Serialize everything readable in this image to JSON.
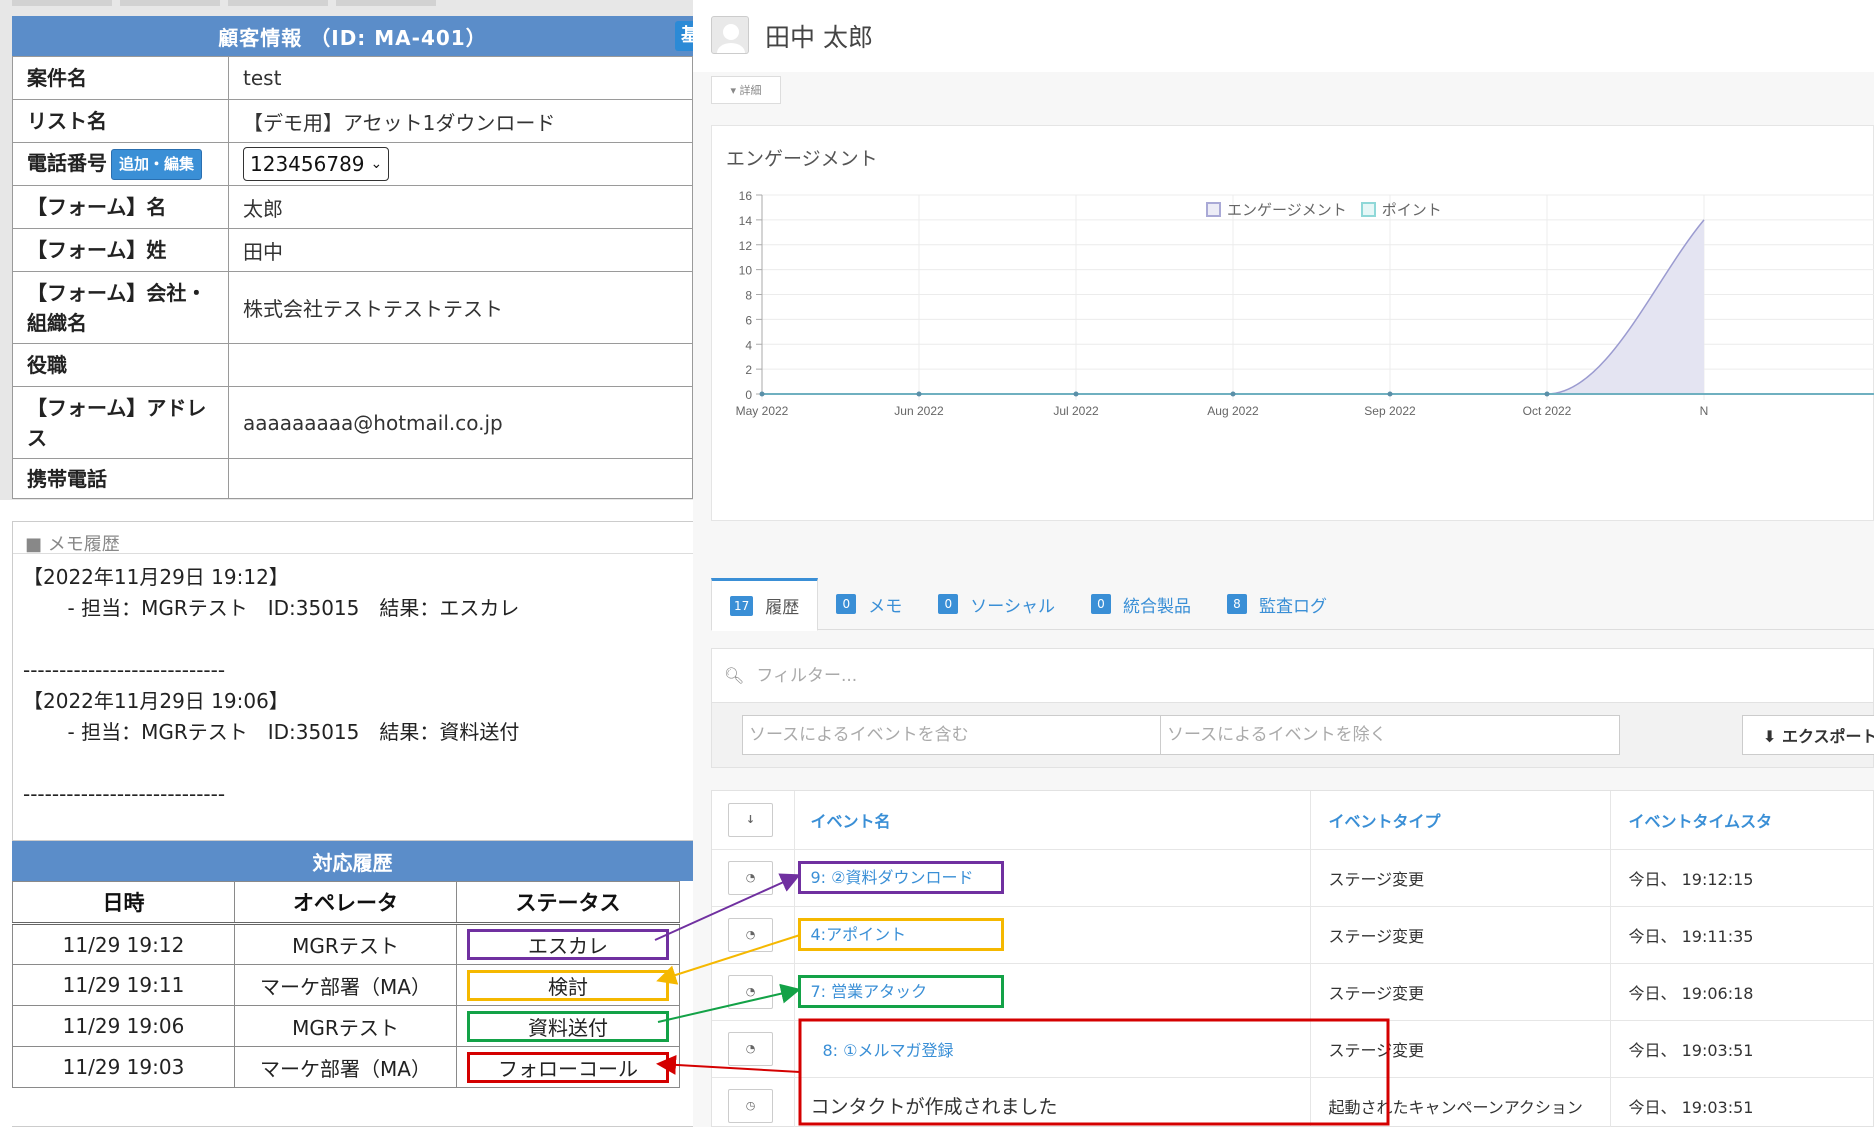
{
  "customer": {
    "header": "顧客情報 （ID: MA-401）",
    "header_btn": "基",
    "rows": [
      {
        "label": "案件名",
        "value": "test"
      },
      {
        "label": "リスト名",
        "value": "【デモ用】アセット1ダウンロード"
      },
      {
        "label": "電話番号",
        "value": "123456789",
        "add_edit": "追加・編集"
      },
      {
        "label": "【フォーム】名",
        "value": "太郎"
      },
      {
        "label": "【フォーム】姓",
        "value": "田中"
      },
      {
        "label": "【フォーム】会社・組織名",
        "value": "株式会社テストテストテスト"
      },
      {
        "label": "役職",
        "value": ""
      },
      {
        "label": "【フォーム】アドレス",
        "value": "aaaaaaaaa@hotmail.co.jp"
      },
      {
        "label": "携帯電話",
        "value": ""
      }
    ]
  },
  "memo": {
    "title": "■ メモ履歴",
    "entries": [
      "【2022年11月29日 19:12】\n       - 担当：MGRテスト　ID:35015　結果：エスカレ\n\n----------------------------",
      "【2022年11月29日 19:06】\n       - 担当：MGRテスト　ID:35015　結果：資料送付\n\n----------------------------"
    ]
  },
  "correspondence": {
    "title": "対応履歴",
    "columns": [
      "日時",
      "オペレータ",
      "ステータス"
    ],
    "rows": [
      {
        "datetime": "11/29 19:12",
        "operator": "MGRテスト",
        "status": "エスカレ",
        "color": "#7030a0"
      },
      {
        "datetime": "11/29 19:11",
        "operator": "マーケ部署（MA）",
        "status": "検討",
        "color": "#f5b800"
      },
      {
        "datetime": "11/29 19:06",
        "operator": "MGRテスト",
        "status": "資料送付",
        "color": "#13a247"
      },
      {
        "datetime": "11/29 19:03",
        "operator": "マーケ部署（MA）",
        "status": "フォローコール",
        "color": "#d40000"
      }
    ]
  },
  "contact": {
    "name": "田中 太郎",
    "detail_label": "▾ 詳細"
  },
  "engagement": {
    "title": "エンゲージメント",
    "legend": [
      "エンゲージメント",
      "ポイント"
    ]
  },
  "chart_data": {
    "type": "area",
    "categories": [
      "May 2022",
      "Jun 2022",
      "Jul 2022",
      "Aug 2022",
      "Sep 2022",
      "Oct 2022",
      "N"
    ],
    "y_ticks": [
      0,
      2,
      4,
      6,
      8,
      10,
      12,
      14,
      16
    ],
    "ylim": [
      0,
      16
    ],
    "grid": true,
    "legend_position": "top-center",
    "series": [
      {
        "name": "エンゲージメント",
        "values": [
          0,
          0,
          0,
          0,
          0,
          0,
          14
        ],
        "color": "#9b9bd0",
        "fill": "#e4e4f2"
      },
      {
        "name": "ポイント",
        "values": [
          0,
          0,
          0,
          0,
          0,
          0,
          0
        ],
        "color": "#7fd0d0"
      }
    ]
  },
  "tabs": [
    {
      "count": "17",
      "label": "履歴",
      "active": true
    },
    {
      "count": "0",
      "label": "メモ"
    },
    {
      "count": "0",
      "label": "ソーシャル"
    },
    {
      "count": "0",
      "label": "統合製品"
    },
    {
      "count": "8",
      "label": "監査ログ"
    }
  ],
  "filters": {
    "search_placeholder": "フィルター...",
    "include_placeholder": "ソースによるイベントを含む",
    "exclude_placeholder": "ソースによるイベントを除く",
    "export_label": "⬇ エクスポート"
  },
  "events": {
    "columns": [
      "イベント名",
      "イベントタイプ",
      "イベントタイムスタ"
    ],
    "sort_icon": "↓",
    "rows": [
      {
        "name": "9: ②資料ダウンロード",
        "type": "ステージ変更",
        "time": "今日、 19:12:15",
        "box": "#7030a0"
      },
      {
        "name": "4:アポイント",
        "type": "ステージ変更",
        "time": "今日、 19:11:35",
        "box": "#f5b800"
      },
      {
        "name": "7: 営業アタック",
        "type": "ステージ変更",
        "time": "今日、 19:06:18",
        "box": "#13a247"
      },
      {
        "name": "8: ①メルマガ登録",
        "type": "ステージ変更",
        "time": "今日、 19:03:51",
        "box": ""
      },
      {
        "name": "コンタクトが作成されました",
        "type": "起動されたキャンペーンアクション",
        "time": "今日、 19:03:51",
        "box": "",
        "plain": true
      }
    ]
  },
  "annotations": {
    "red_group_color": "#d40000"
  }
}
